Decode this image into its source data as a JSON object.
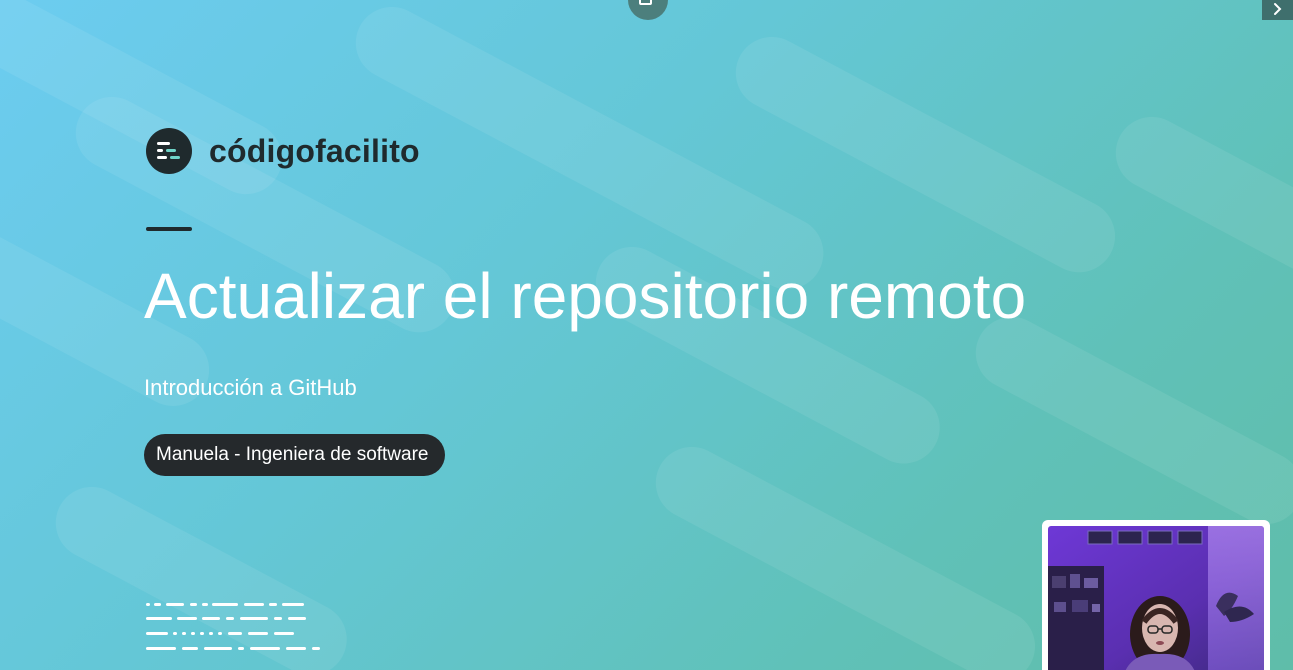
{
  "brand": {
    "name": "códigofacilito",
    "text_color": "#1f2a2d"
  },
  "slide": {
    "title": "Actualizar el repositorio remoto",
    "subtitle": "Introducción a GitHub",
    "author": "Manuela - Ingeniera de software",
    "background_start": "#6cccf0",
    "background_end": "#5fbda9"
  },
  "controls": {
    "popout_icon": "popout-icon",
    "next_icon": "chevron-right-icon"
  },
  "webcam": {
    "subject": "presenter"
  }
}
